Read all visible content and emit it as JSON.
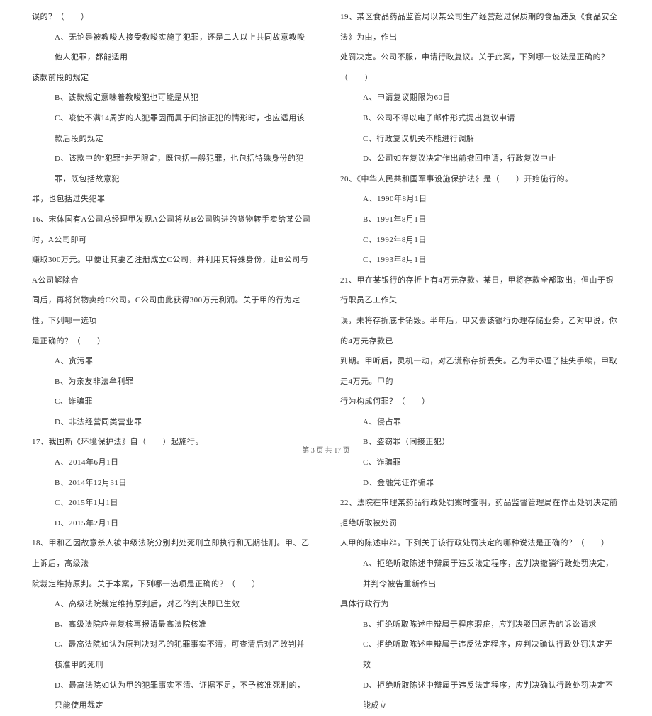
{
  "leftColumn": {
    "q15_cont": "误的？（　　）",
    "q15_optA": "A、无论是被教唆人接受教唆实施了犯罪，还是二人以上共同故意教唆他人犯罪，都能适用",
    "q15_optA_cont": "该款前段的规定",
    "q15_optB": "B、该款规定意味着教唆犯也可能是从犯",
    "q15_optC": "C、唆使不满14周岁的人犯罪因而属于间接正犯的情形时，也应适用该款后段的规定",
    "q15_optD": "D、该款中的\"犯罪\"并无限定，既包括一般犯罪，也包括特殊身份的犯罪，既包括故意犯",
    "q15_optD_cont": "罪，也包括过失犯罪",
    "q16": "16、宋体国有A公司总经理甲发现A公司将从B公司购进的货物转手卖给某公司时，A公司即可",
    "q16_cont1": "赚取300万元。甲便让其妻乙注册成立C公司，并利用其特殊身份，让B公司与A公司解除合",
    "q16_cont2": "同后，再将货物卖给C公司。C公司由此获得300万元利润。关于甲的行为定性，下列哪一选项",
    "q16_cont3": "是正确的？（　　）",
    "q16_optA": "A、贪污罪",
    "q16_optB": "B、为亲友非法牟利罪",
    "q16_optC": "C、诈骗罪",
    "q16_optD": "D、非法经营同类营业罪",
    "q17": "17、我国新《环境保护法》自（　　）起施行。",
    "q17_optA": "A、2014年6月1日",
    "q17_optB": "B、2014年12月31日",
    "q17_optC": "C、2015年1月1日",
    "q17_optD": "D、2015年2月1日",
    "q18": "18、甲和乙因故意杀人被中级法院分别判处死刑立即执行和无期徒刑。甲、乙上诉后，高级法",
    "q18_cont": "院裁定维持原判。关于本案，下列哪一选项是正确的？（　　）",
    "q18_optA": "A、高级法院裁定维持原判后，对乙的判决即已生效",
    "q18_optB": "B、高级法院应先复核再报请最高法院核准",
    "q18_optC": "C、最高法院如认为原判决对乙的犯罪事实不清，可查清后对乙改判并核准甲的死刑",
    "q18_optD": "D、最高法院如认为甲的犯罪事实不清、证据不足，不予核准死刑的，只能使用裁定"
  },
  "rightColumn": {
    "q19": "19、某区食品药品监管局以某公司生产经营超过保质期的食品违反《食品安全法》为由，作出",
    "q19_cont": "处罚决定。公司不服，申请行政复议。关于此案，下列哪一说法是正确的？（　　）",
    "q19_optA": "A、申请复议期限为60日",
    "q19_optB": "B、公司不得以电子邮件形式提出复议申请",
    "q19_optC": "C、行政复议机关不能进行调解",
    "q19_optD": "D、公司如在复议决定作出前撤回申请，行政复议中止",
    "q20": "20、《中华人民共和国军事设施保护法》是（　　）开始施行的。",
    "q20_optA": "A、1990年8月1日",
    "q20_optB": "B、1991年8月1日",
    "q20_optC": "C、1992年8月1日",
    "q20_optD": "C、1993年8月1日",
    "q21": "21、甲在某银行的存折上有4万元存款。某日，甲将存款全部取出，但由于银行职员乙工作失",
    "q21_cont1": "误，未将存折底卡销毁。半年后，甲又去该银行办理存储业务，乙对甲说，你的4万元存款已",
    "q21_cont2": "到期。甲听后，灵机一动，对乙谎称存折丢失。乙为甲办理了挂失手续，甲取走4万元。甲的",
    "q21_cont3": "行为构成何罪？（　　）",
    "q21_optA": "A、侵占罪",
    "q21_optB": "B、盗窃罪（间接正犯）",
    "q21_optC": "C、诈骗罪",
    "q21_optD": "D、金融凭证诈骗罪",
    "q22": "22、法院在审理某药品行政处罚案时查明，药品监督管理局在作出处罚决定前拒绝听取被处罚",
    "q22_cont": "人甲的陈述申辩。下列关于该行政处罚决定的哪种说法是正确的？（　　）",
    "q22_optA": "A、拒绝听取陈述申辩属于违反法定程序，应判决撤销行政处罚决定，并判令被告重新作出",
    "q22_optA_cont": "具体行政行为",
    "q22_optB": "B、拒绝听取陈述申辩属于程序瑕疵，应判决驳回原告的诉讼请求",
    "q22_optC": "C、拒绝听取陈述申辩属于违反法定程序，应判决确认行政处罚决定无效",
    "q22_optD": "D、拒绝听取陈述中辩属于违反法定程序，应判决确认行政处罚决定不能成立"
  },
  "footer": "第 3 页 共 17 页"
}
